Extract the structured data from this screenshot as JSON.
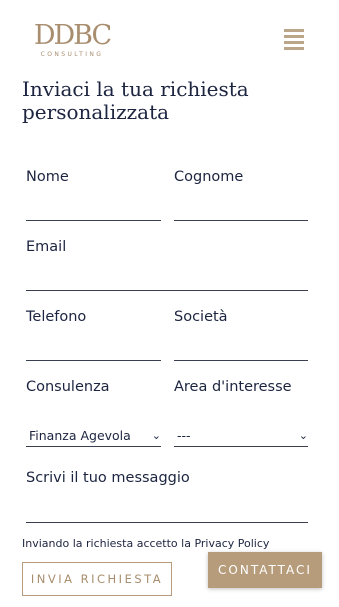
{
  "brand": {
    "logo_main": "DDBC",
    "logo_sub": "CONSULTING",
    "color": "#a88e6e"
  },
  "header": {
    "menu_icon": "hamburger-menu-icon"
  },
  "form": {
    "title_line1": "Inviaci la tua richiesta",
    "title_line2": "personalizzata",
    "fields": {
      "nome": {
        "label": "Nome",
        "value": ""
      },
      "cognome": {
        "label": "Cognome",
        "value": ""
      },
      "email": {
        "label": "Email",
        "value": ""
      },
      "telefono": {
        "label": "Telefono",
        "value": ""
      },
      "societa": {
        "label": "Società",
        "value": ""
      },
      "consulenza": {
        "label": "Consulenza",
        "selected": "Finanza Agevola"
      },
      "area": {
        "label": "Area d'interesse",
        "selected": "---"
      },
      "messaggio": {
        "label": "Scrivi il tuo messaggio",
        "value": ""
      }
    },
    "privacy_text": "Inviando la richiesta accetto la Privacy Policy",
    "submit_label": "INVIA RICHIESTA"
  },
  "contact_button": {
    "label": "CONTATTACI",
    "color": "#b79c7b"
  }
}
